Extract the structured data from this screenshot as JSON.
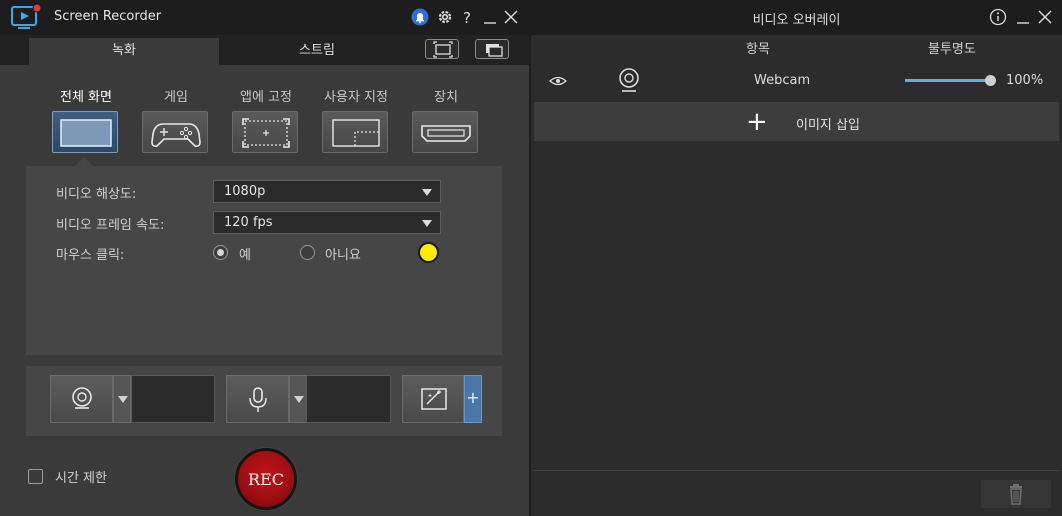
{
  "recorder": {
    "title": "Screen Recorder",
    "tabs": [
      {
        "label": "녹화",
        "active": true
      },
      {
        "label": "스트림",
        "active": false
      }
    ],
    "modes": [
      {
        "label": "전체 화면",
        "icon": "fullscreen-icon",
        "selected": true
      },
      {
        "label": "게임",
        "icon": "gamepad-icon",
        "selected": false
      },
      {
        "label": "앱에 고정",
        "icon": "app-lock-icon",
        "selected": false
      },
      {
        "label": "사용자 지정",
        "icon": "custom-area-icon",
        "selected": false
      },
      {
        "label": "장치",
        "icon": "hdmi-device-icon",
        "selected": false
      }
    ],
    "settings": {
      "resolution_label": "비디오 해상도:",
      "resolution_value": "1080p",
      "framerate_label": "비디오 프레임 속도:",
      "framerate_value": "120 fps",
      "mouse_click_label": "마우스 클릭:",
      "mouse_click_yes": "예",
      "mouse_click_no": "아니요",
      "mouse_click_selected": "예",
      "click_color": "#ffec00"
    },
    "devices": [
      "webcam-icon",
      "microphone-icon",
      "effects-icon"
    ],
    "time_limit_label": "시간 제한",
    "time_limit_checked": false,
    "rec_label": "REC",
    "rec_color": "#b01218"
  },
  "overlay": {
    "title": "비디오 오버레이",
    "col_item": "항목",
    "col_opacity": "불투명도",
    "items": [
      {
        "name": "Webcam",
        "opacity_value": 100,
        "opacity": "100%",
        "visible": true
      }
    ],
    "insert_label": "이미지 삽입",
    "accent": "#5bb3e0"
  }
}
